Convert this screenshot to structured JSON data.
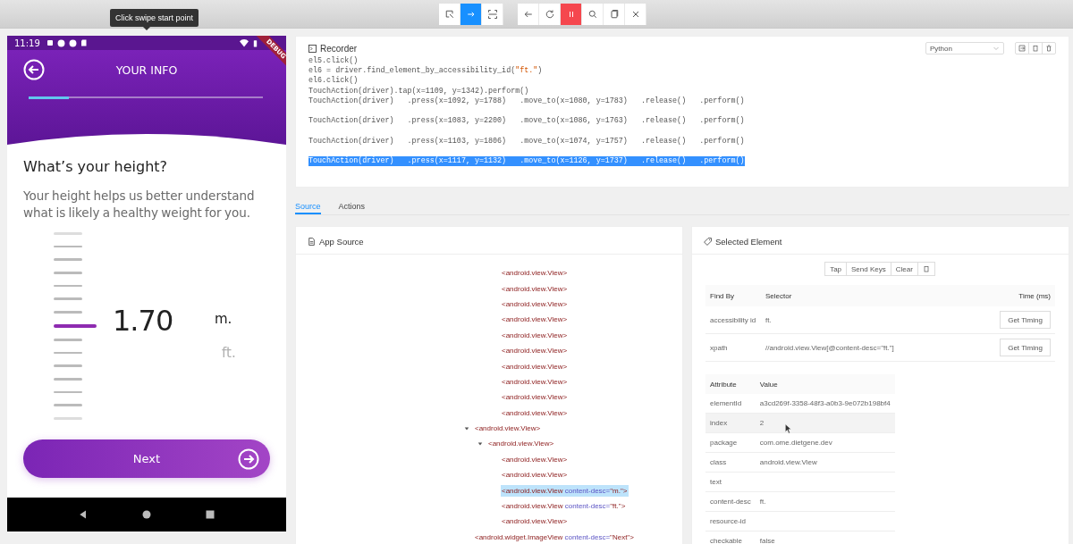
{
  "toolbar": {
    "mode_buttons": [
      {
        "kind": "select",
        "selected": false
      },
      {
        "kind": "swipe",
        "selected": true
      },
      {
        "kind": "region",
        "selected": false
      }
    ],
    "action_buttons": [
      {
        "kind": "back"
      },
      {
        "kind": "refresh"
      },
      {
        "kind": "pause"
      },
      {
        "kind": "search"
      },
      {
        "kind": "copy"
      },
      {
        "kind": "close"
      }
    ],
    "tooltip": "Click swipe start point"
  },
  "phone": {
    "status_time": "11:19",
    "banner": "DEBUG",
    "title": "YOUR INFO",
    "progress": {
      "level": 0.17
    },
    "heading": "What’s your height?",
    "body": "Your height helps us better understand what is likely a healthy weight for you.",
    "ruler": [
      {
        "selected": false
      },
      {
        "selected": false
      },
      {
        "selected": false
      },
      {
        "selected": false
      },
      {
        "selected": false
      },
      {
        "selected": false
      },
      {
        "selected": false
      },
      {
        "selected": true
      },
      {
        "selected": false
      },
      {
        "selected": false
      },
      {
        "selected": false
      },
      {
        "selected": false
      },
      {
        "selected": false
      },
      {
        "selected": false
      },
      {
        "selected": false
      }
    ],
    "value": "1.70",
    "units": [
      {
        "label": "m.",
        "selected": true
      },
      {
        "label": "ft.",
        "selected": false
      }
    ],
    "next_button": "Next"
  },
  "recorder": {
    "title": "Recorder",
    "language": "Python",
    "lines": [
      {
        "kind": "call",
        "text": "el5.click()",
        "selected": false
      },
      {
        "kind": "call",
        "text": "el6 = driver.find_element_by_accessibility_id(",
        "string": "\"ft.\"",
        "after": ")",
        "selected": false
      },
      {
        "kind": "call",
        "text": "el6.click()",
        "selected": false
      },
      {
        "kind": "call",
        "text": "TouchAction(driver).tap(x=1109, y=1342).perform()",
        "selected": false
      },
      {
        "kind": "chain",
        "text": "TouchAction(driver)   .press(x=1092, y=1788)   .move_to(x=1080, y=1783)   .release()   .perform()",
        "selected": false
      },
      {
        "kind": "chain",
        "text": "TouchAction(driver)   .press(x=1083, y=2200)   .move_to(x=1086, y=1763)   .release()   .perform()",
        "selected": false
      },
      {
        "kind": "chain",
        "text": "TouchAction(driver)   .press(x=1103, y=1806)   .move_to(x=1074, y=1757)   .release()   .perform()",
        "selected": false
      },
      {
        "kind": "chain",
        "text": "TouchAction(driver)   .press(x=1117, y=1132)   .move_to(x=1126, y=1737)   .release()   .perform()",
        "selected": true
      }
    ]
  },
  "tabs": [
    {
      "label": "Source",
      "selected": true
    },
    {
      "label": "Actions",
      "selected": false
    }
  ],
  "app_source": {
    "title": "App Source",
    "tree": [
      {
        "children": [
          {
            "children": [
              {
                "tag": "<android.view.View>",
                "selected": false
              },
              {
                "tag": "<android.view.View>",
                "selected": false
              },
              {
                "tag": "<android.view.View>",
                "selected": false
              },
              {
                "tag": "<android.view.View>",
                "selected": false
              },
              {
                "tag": "<android.view.View>",
                "selected": false
              },
              {
                "tag": "<android.view.View>",
                "selected": false
              },
              {
                "tag": "<android.view.View>",
                "selected": false
              },
              {
                "tag": "<android.view.View>",
                "selected": false
              },
              {
                "tag": "<android.view.View>",
                "selected": false
              },
              {
                "tag": "<android.view.View>",
                "selected": false
              }
            ]
          }
        ]
      },
      {
        "tag": "<android.view.View>",
        "selected": false,
        "expanded": true,
        "children": [
          {
            "tag": "<android.view.View>",
            "selected": false,
            "expanded": true,
            "children": [
              {
                "tag": "<android.view.View>",
                "selected": false
              },
              {
                "tag": "<android.view.View>",
                "selected": false
              },
              {
                "tag": "<android.view.View",
                "selected": true,
                "attr_name": "content-desc=",
                "attr_value": "\"m.\">"
              },
              {
                "tag": "<android.view.View",
                "selected": false,
                "attr_name": "content-desc=",
                "attr_value": "\"ft.\">"
              },
              {
                "tag": "<android.view.View>",
                "selected": false
              }
            ]
          }
        ]
      },
      {
        "tag": "<android.widget.ImageView",
        "selected": false,
        "attr_name": "content-desc=",
        "attr_value": "\"Next\">"
      }
    ]
  },
  "selected_element": {
    "title": "Selected Element",
    "actions": [
      "Tap",
      "Send Keys",
      "Clear"
    ],
    "find_by": {
      "columns": [
        "Find By",
        "Selector",
        "Time (ms)"
      ],
      "rows": [
        {
          "find_by": "accessibility id",
          "selector": "ft.",
          "button": "Get Timing"
        },
        {
          "find_by": "xpath",
          "selector": "//android.view.View[@content-desc=\"ft.\"]",
          "button": "Get Timing"
        }
      ]
    },
    "attributes": {
      "columns": [
        "Attribute",
        "Value"
      ],
      "rows": [
        {
          "attribute": "elementId",
          "value": "a3cd269f-3358-48f3-a0b3-9e072b198bf4",
          "hovered": false
        },
        {
          "attribute": "index",
          "value": "2",
          "hovered": true
        },
        {
          "attribute": "package",
          "value": "com.ome.dietgene.dev",
          "hovered": false
        },
        {
          "attribute": "class",
          "value": "android.view.View",
          "hovered": false
        },
        {
          "attribute": "text",
          "hovered": false
        },
        {
          "attribute": "content-desc",
          "value": "ft.",
          "hovered": false
        },
        {
          "attribute": "resource-id",
          "hovered": false
        },
        {
          "attribute": "checkable",
          "value": "false",
          "hovered": false
        }
      ]
    }
  }
}
